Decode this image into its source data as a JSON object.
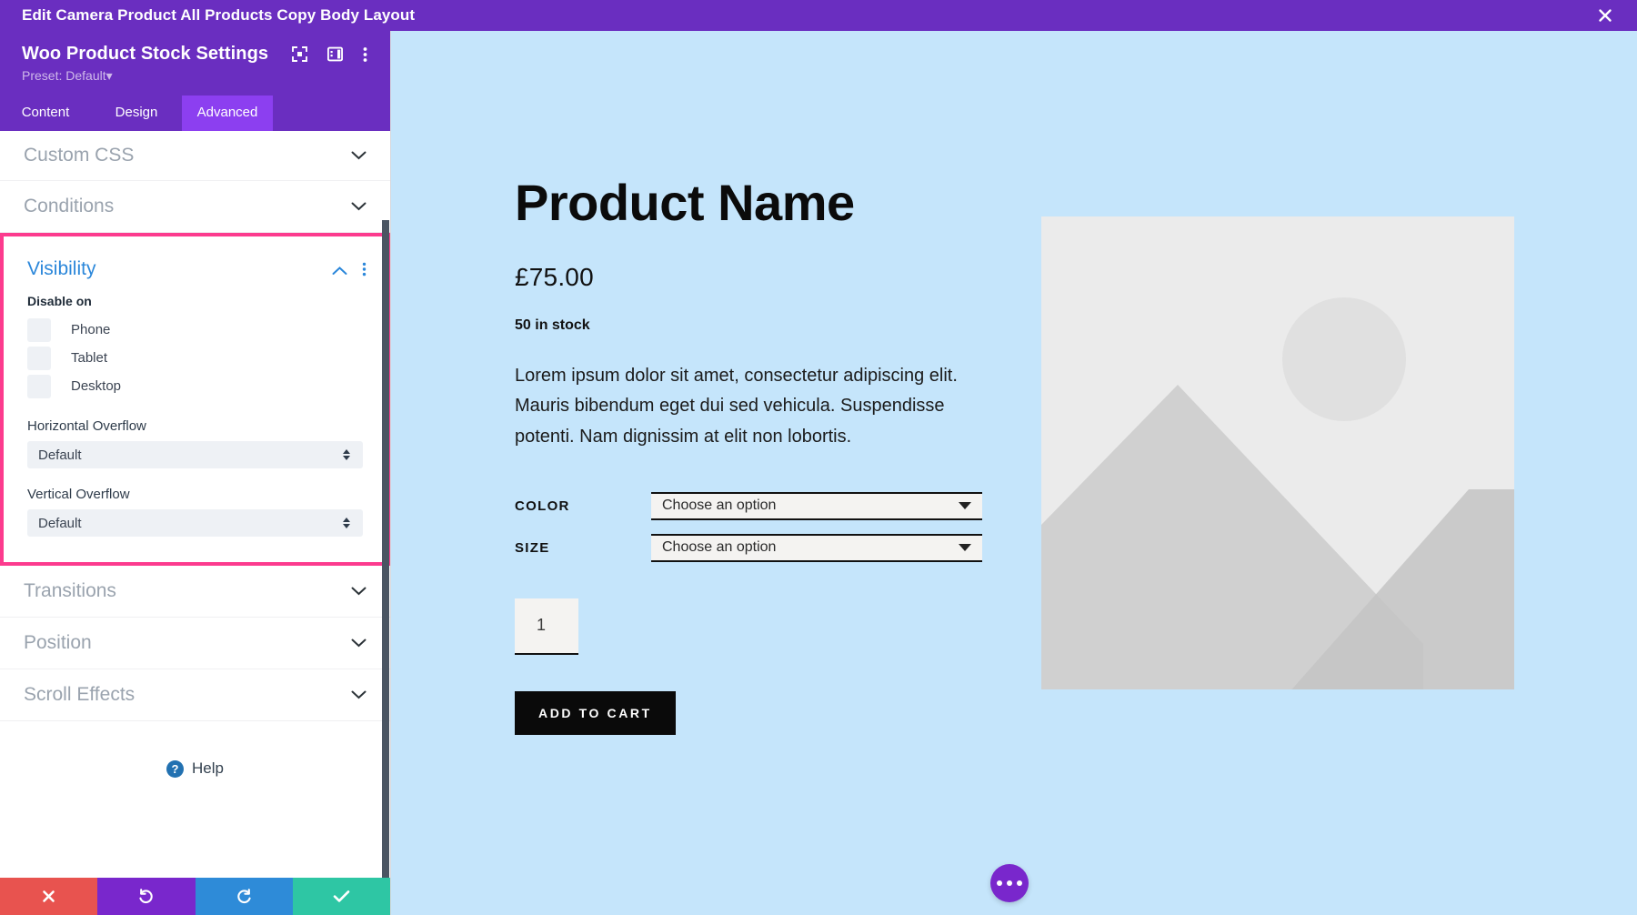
{
  "topbar": {
    "title": "Edit Camera Product All Products Copy Body Layout",
    "close_icon": "close-icon"
  },
  "panel": {
    "module_name": "Woo Product Stock Settings",
    "preset": "Preset: Default",
    "preset_caret": "▾",
    "header_icons": [
      "focus-target-icon",
      "layout-panel-icon",
      "more-vertical-icon"
    ],
    "tabs": [
      {
        "label": "Content",
        "active": false
      },
      {
        "label": "Design",
        "active": false
      },
      {
        "label": "Advanced",
        "active": true
      }
    ],
    "accordions_above": [
      {
        "label": "Custom CSS",
        "chevron": "⌄"
      },
      {
        "label": "Conditions",
        "chevron": "⌄"
      }
    ],
    "visibility": {
      "title": "Visibility",
      "collapse_icon": "chevron-up-icon",
      "menu_icon": "more-vertical-icon",
      "disable_on_label": "Disable on",
      "devices": [
        {
          "label": "Phone",
          "checked": false
        },
        {
          "label": "Tablet",
          "checked": false
        },
        {
          "label": "Desktop",
          "checked": false
        }
      ],
      "horizontal_overflow": {
        "label": "Horizontal Overflow",
        "value": "Default"
      },
      "vertical_overflow": {
        "label": "Vertical Overflow",
        "value": "Default"
      },
      "highlight_color": "#fc3b8e"
    },
    "accordions_below": [
      {
        "label": "Transitions",
        "chevron": "⌄"
      },
      {
        "label": "Position",
        "chevron": "⌄"
      },
      {
        "label": "Scroll Effects",
        "chevron": "⌄"
      }
    ],
    "help": {
      "label": "Help",
      "badge": "?"
    },
    "actions": [
      {
        "name": "cancel",
        "icon": "close-icon",
        "color": "#e8534f"
      },
      {
        "name": "undo",
        "icon": "undo-icon",
        "color": "#7927cc"
      },
      {
        "name": "redo",
        "icon": "redo-icon",
        "color": "#2e8bd8"
      },
      {
        "name": "save",
        "icon": "check-icon",
        "color": "#2ec6a4"
      }
    ]
  },
  "preview": {
    "background_color": "#c5e5fb",
    "product": {
      "name": "Product Name",
      "price": "£75.00",
      "stock": "50 in stock",
      "description": "Lorem ipsum dolor sit amet, consectetur adipiscing elit. Mauris bibendum eget dui sed vehicula. Suspendisse potenti. Nam dignissim at elit non lobortis.",
      "variations": [
        {
          "label": "COLOR",
          "value": "Choose an option"
        },
        {
          "label": "SIZE",
          "value": "Choose an option"
        }
      ],
      "quantity": "1",
      "add_to_cart": "ADD TO CART",
      "image_placeholder": "image-placeholder-icon"
    },
    "fab": {
      "icon": "more-horizontal-icon",
      "color": "#7927cc"
    }
  }
}
